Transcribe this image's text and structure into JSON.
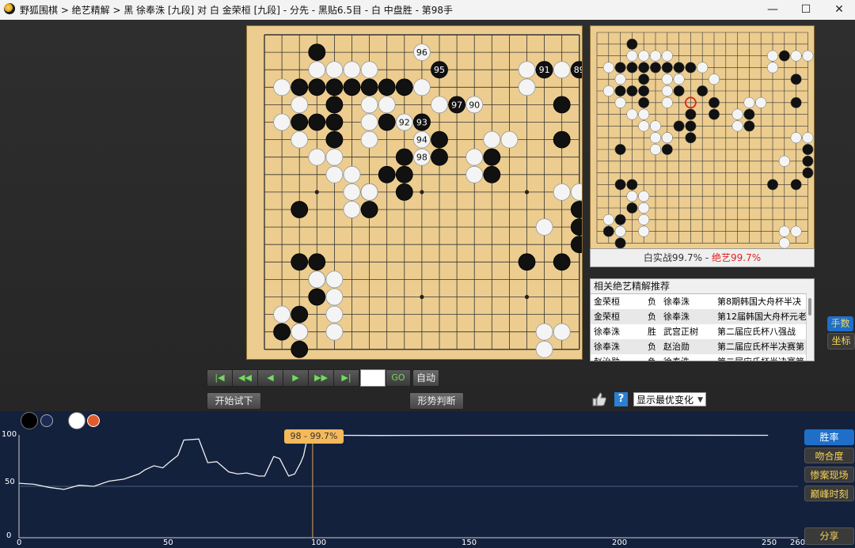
{
  "window": {
    "title": "野狐围棋 > 绝艺精解 > 黑 徐奉洙 [九段] 对 白 金荣桓 [九段] - 分先 - 黑贴6.5目 - 白 中盘胜 - 第98手",
    "minimize": "—",
    "maximize": "☐",
    "close": "✕"
  },
  "board": {
    "size": 19,
    "black": [
      [
        3,
        1
      ],
      [
        2,
        3
      ],
      [
        3,
        3
      ],
      [
        4,
        3
      ],
      [
        5,
        3
      ],
      [
        6,
        3
      ],
      [
        7,
        3
      ],
      [
        8,
        3
      ],
      [
        4,
        4
      ],
      [
        4,
        5
      ],
      [
        2,
        5
      ],
      [
        3,
        5
      ],
      [
        7,
        5
      ],
      [
        9,
        5
      ],
      [
        4,
        6
      ],
      [
        10,
        6
      ],
      [
        10,
        7
      ],
      [
        13,
        7
      ],
      [
        13,
        8
      ],
      [
        7,
        8
      ],
      [
        8,
        8
      ],
      [
        8,
        7
      ],
      [
        8,
        9
      ],
      [
        6,
        9
      ],
      [
        6,
        10
      ],
      [
        2,
        10
      ],
      [
        2,
        13
      ],
      [
        3,
        13
      ],
      [
        3,
        14
      ],
      [
        3,
        15
      ],
      [
        2,
        16
      ],
      [
        1,
        17
      ],
      [
        2,
        17
      ],
      [
        2,
        18
      ],
      [
        17,
        6
      ],
      [
        20,
        6
      ],
      [
        17,
        4
      ],
      [
        16,
        2
      ],
      [
        19,
        3
      ],
      [
        18,
        10
      ],
      [
        18,
        11
      ],
      [
        18,
        12
      ],
      [
        15,
        13
      ],
      [
        17,
        13
      ]
    ],
    "white": [
      [
        3,
        2
      ],
      [
        4,
        2
      ],
      [
        5,
        2
      ],
      [
        6,
        2
      ],
      [
        1,
        3
      ],
      [
        2,
        4
      ],
      [
        1,
        5
      ],
      [
        2,
        6
      ],
      [
        3,
        7
      ],
      [
        4,
        7
      ],
      [
        5,
        8
      ],
      [
        4,
        8
      ],
      [
        5,
        9
      ],
      [
        6,
        9
      ],
      [
        5,
        10
      ],
      [
        6,
        6
      ],
      [
        6,
        5
      ],
      [
        6,
        4
      ],
      [
        7,
        4
      ],
      [
        9,
        3
      ],
      [
        10,
        4
      ],
      [
        12,
        7
      ],
      [
        12,
        8
      ],
      [
        13,
        6
      ],
      [
        14,
        6
      ],
      [
        15,
        2
      ],
      [
        15,
        3
      ],
      [
        17,
        2
      ],
      [
        18,
        2
      ],
      [
        19,
        2
      ],
      [
        17,
        9
      ],
      [
        18,
        9
      ],
      [
        16,
        11
      ],
      [
        3,
        14
      ],
      [
        4,
        14
      ],
      [
        4,
        15
      ],
      [
        4,
        16
      ],
      [
        4,
        17
      ],
      [
        1,
        16
      ],
      [
        2,
        17
      ],
      [
        16,
        17
      ],
      [
        17,
        17
      ],
      [
        16,
        18
      ],
      [
        16,
        19
      ]
    ],
    "numbered": [
      {
        "col": 9,
        "row": 1,
        "color": "white",
        "label": "96"
      },
      {
        "col": 10,
        "row": 2,
        "color": "black",
        "label": "95"
      },
      {
        "col": 16,
        "row": 2,
        "color": "black",
        "label": "91"
      },
      {
        "col": 18,
        "row": 2,
        "color": "black",
        "label": "89"
      },
      {
        "col": 11,
        "row": 4,
        "color": "black",
        "label": "97"
      },
      {
        "col": 12,
        "row": 4,
        "color": "white",
        "label": "90"
      },
      {
        "col": 8,
        "row": 5,
        "color": "white",
        "label": "92"
      },
      {
        "col": 9,
        "row": 5,
        "color": "black",
        "label": "93"
      },
      {
        "col": 9,
        "row": 6,
        "color": "white",
        "label": "94"
      },
      {
        "col": 9,
        "row": 7,
        "color": "white",
        "label": "98"
      }
    ]
  },
  "minimap": {
    "summary_left": "白实战99.7%",
    "summary_sep": " - ",
    "summary_right": "绝艺99.7%"
  },
  "records": {
    "header": "相关绝艺精解推荐",
    "rows": [
      {
        "p1": "金荣桓",
        "res": "负",
        "p2": "徐奉洙",
        "event": "第8期韩国大舟杯半决"
      },
      {
        "p1": "金荣桓",
        "res": "负",
        "p2": "徐奉洙",
        "event": "第12届韩国大舟杯元老"
      },
      {
        "p1": "徐奉洙",
        "res": "胜",
        "p2": "武宫正树",
        "event": "第二届应氏杯八强战"
      },
      {
        "p1": "徐奉洙",
        "res": "负",
        "p2": "赵治勋",
        "event": "第二届应氏杯半决赛第"
      },
      {
        "p1": "赵治勋",
        "res": "负",
        "p2": "徐奉洙",
        "event": "第二届应氏杯半决赛第"
      }
    ]
  },
  "side": {
    "moves": "手数",
    "coords": "坐标"
  },
  "controls": {
    "first": "|◀",
    "prev5": "◀◀",
    "prev": "◀",
    "next": "▶",
    "next5": "▶▶",
    "last": "▶|",
    "go": "GO",
    "auto": "自动",
    "try": "开始试下",
    "judge": "形势判断",
    "help": "?",
    "variation": "显示最优变化",
    "variation_caret": "▼"
  },
  "chart": {
    "tooltip": "98 - 99.7%",
    "buttons": [
      "胜率",
      "吻合度",
      "惨案现场",
      "巅峰时刻"
    ],
    "share": "分享",
    "ytick": [
      "100",
      "50",
      "0"
    ],
    "xtick": [
      "0",
      "50",
      "100",
      "150",
      "200",
      "250",
      "260"
    ]
  },
  "chart_data": {
    "type": "line",
    "x_range": [
      0,
      260
    ],
    "y_range": [
      0,
      100
    ],
    "series": [
      {
        "values": [
          [
            0,
            53
          ],
          [
            5,
            52
          ],
          [
            10,
            49
          ],
          [
            15,
            47
          ],
          [
            20,
            51
          ],
          [
            25,
            50
          ],
          [
            30,
            55
          ],
          [
            35,
            57
          ],
          [
            40,
            62
          ],
          [
            42,
            66
          ],
          [
            45,
            70
          ],
          [
            48,
            68
          ],
          [
            50,
            73
          ],
          [
            53,
            80
          ],
          [
            55,
            95
          ],
          [
            60,
            96
          ],
          [
            63,
            73
          ],
          [
            66,
            74
          ],
          [
            70,
            64
          ],
          [
            73,
            62
          ],
          [
            76,
            63
          ],
          [
            80,
            60
          ],
          [
            82,
            60
          ],
          [
            85,
            79
          ],
          [
            87,
            77
          ],
          [
            90,
            60
          ],
          [
            92,
            62
          ],
          [
            94,
            73
          ],
          [
            95,
            80
          ],
          [
            96,
            94
          ],
          [
            97,
            94
          ],
          [
            98,
            99.7
          ],
          [
            120,
            99.5
          ],
          [
            150,
            99.6
          ],
          [
            200,
            99.7
          ],
          [
            250,
            99.6
          ]
        ]
      }
    ]
  },
  "colors": {
    "board": "#eccd8f",
    "accent": "#1f6fc9",
    "gold": "#f5d35a",
    "chart_bg": "#14213d"
  }
}
